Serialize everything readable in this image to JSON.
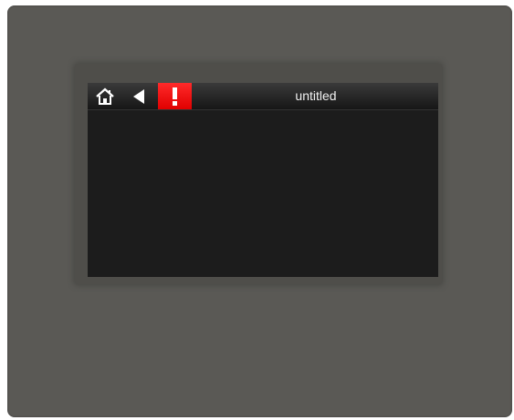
{
  "window": {
    "title": "untitled"
  },
  "toolbar": {
    "home_icon": "home-icon",
    "back_icon": "back-arrow-icon",
    "alert_icon": "exclamation-icon"
  },
  "colors": {
    "device_body": "#5a5955",
    "screen_background": "#1c1c1c",
    "alert_accent": "#e00000",
    "title_text": "#f2f2f2"
  }
}
